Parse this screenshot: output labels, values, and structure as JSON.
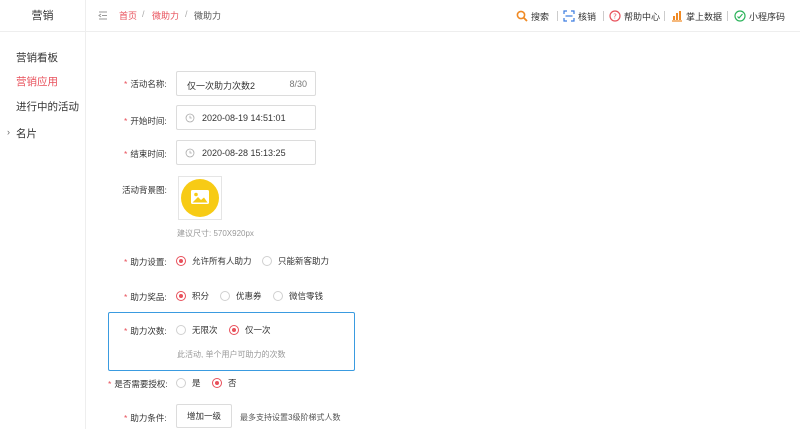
{
  "sidebar": {
    "title": "营销",
    "items": [
      {
        "label": "营销看板",
        "active": false
      },
      {
        "label": "营销应用",
        "active": true
      },
      {
        "label": "进行中的活动",
        "active": false
      },
      {
        "label": "名片",
        "active": false,
        "has_arrow": true
      }
    ],
    "arrow": "›"
  },
  "breadcrumb": {
    "home": "首页",
    "sep": "/",
    "parent": "微助力",
    "current": "微助力"
  },
  "top_actions": {
    "search": "搜索",
    "verify": "核销",
    "help": "帮助中心",
    "data": "掌上数据",
    "miniprogram": "小程序码"
  },
  "colors": {
    "accent": "#e8505b",
    "focus_border": "#3a9be0",
    "upload_yellow": "#f7cb15"
  },
  "form": {
    "activity_name": {
      "label": "活动名称:",
      "value": "仅一次助力次数2",
      "count": "8/30"
    },
    "start_time": {
      "label": "开始时间:",
      "value": "2020-08-19 14:51:01"
    },
    "end_time": {
      "label": "结束时间:",
      "value": "2020-08-28 15:13:25"
    },
    "background": {
      "label": "活动背景图:",
      "hint": "建议尺寸: 570X920px"
    },
    "help_setting": {
      "label": "助力设置:",
      "options": [
        "允许所有人助力",
        "只能新客助力"
      ],
      "selected": 0
    },
    "help_reward": {
      "label": "助力奖品:",
      "options": [
        "积分",
        "优惠券",
        "微信零钱"
      ],
      "selected": 0
    },
    "help_count": {
      "label": "助力次数:",
      "options": [
        "无限次",
        "仅一次"
      ],
      "selected": 1,
      "hint": "此活动, 单个用户可助力的次数"
    },
    "need_auth": {
      "label": "是否需要授权:",
      "options": [
        "是",
        "否"
      ],
      "selected": 1
    },
    "help_condition": {
      "label": "助力条件:",
      "button": "增加一级",
      "hint": "最多支持设置3级阶梯式人数"
    }
  },
  "required_mark": "*"
}
